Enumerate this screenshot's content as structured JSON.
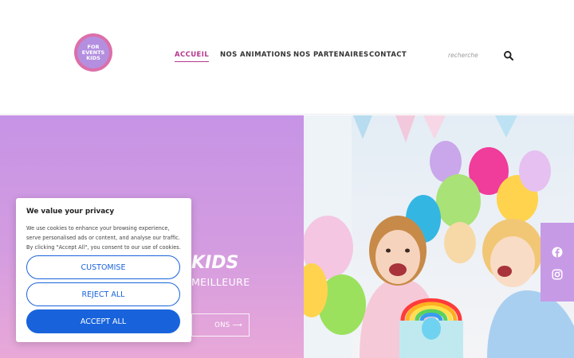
{
  "logo": {
    "line1": "FOR",
    "line2": "EVENTS",
    "line3": "KIDS"
  },
  "nav": {
    "items": [
      {
        "label": "ACCUEIL",
        "active": true
      },
      {
        "label": "NOS ANIMATIONS",
        "active": false
      },
      {
        "label": "NOS PARTENAIRES",
        "active": false
      },
      {
        "label": "CONTACT",
        "active": false
      }
    ]
  },
  "search": {
    "placeholder": "recherche"
  },
  "hero": {
    "title": "KIDS",
    "subtitle": "MEILLEURE",
    "cta_label": "ONS ⟶"
  },
  "cookie": {
    "title": "We value your privacy",
    "text": "We use cookies to enhance your browsing experience, serve personalised ads or content, and analyse our traffic. By clicking \"Accept All\", you consent to our use of cookies.",
    "customise": "CUSTOMISE",
    "reject": "REJECT ALL",
    "accept": "ACCEPT ALL"
  },
  "colors": {
    "accent": "#b5388c",
    "hero_gradient_top": "#c694e6",
    "hero_gradient_bottom": "#e8a8d8",
    "cookie_button": "#1863dc",
    "social_bar": "#c79ae6"
  },
  "icons": {
    "search": "search-icon",
    "facebook": "facebook-icon",
    "instagram": "instagram-icon"
  }
}
